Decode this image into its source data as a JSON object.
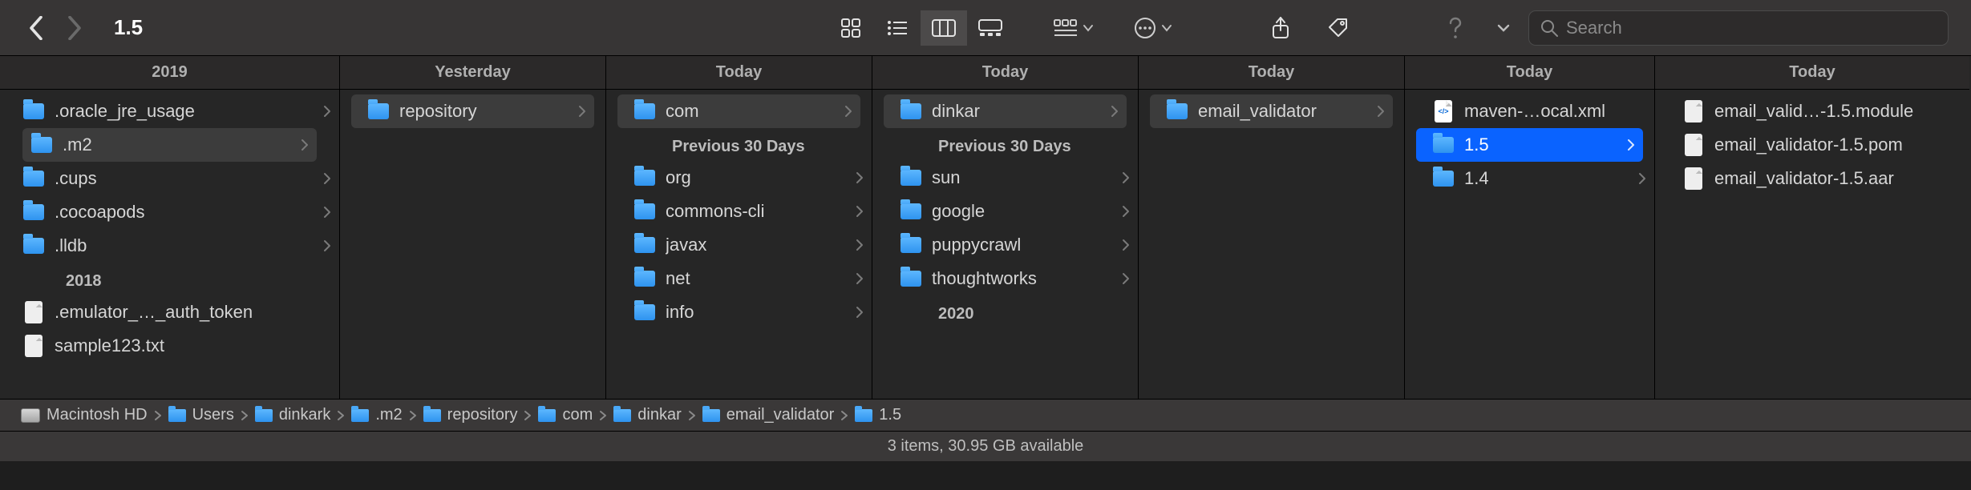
{
  "window": {
    "title": "1.5"
  },
  "search": {
    "placeholder": "Search"
  },
  "columns": [
    {
      "header": "2019",
      "sections": [
        {
          "label": "",
          "items": [
            {
              "name": ".oracle_jre_usage",
              "type": "folder",
              "has_children": true
            },
            {
              "name": ".m2",
              "type": "folder",
              "has_children": true,
              "selected": "light"
            },
            {
              "name": ".cups",
              "type": "folder",
              "has_children": true
            },
            {
              "name": ".cocoapods",
              "type": "folder",
              "has_children": true
            },
            {
              "name": ".lldb",
              "type": "folder",
              "has_children": true
            }
          ]
        },
        {
          "label": "2018",
          "items": [
            {
              "name": ".emulator_…_auth_token",
              "type": "file"
            },
            {
              "name": "sample123.txt",
              "type": "file"
            }
          ]
        }
      ]
    },
    {
      "header": "Yesterday",
      "sections": [
        {
          "label": "",
          "items": [
            {
              "name": "repository",
              "type": "folder",
              "has_children": true,
              "selected": "light"
            }
          ]
        }
      ]
    },
    {
      "header": "Today",
      "sections": [
        {
          "label": "",
          "items": [
            {
              "name": "com",
              "type": "folder",
              "has_children": true,
              "selected": "light"
            }
          ]
        },
        {
          "label": "Previous 30 Days",
          "items": [
            {
              "name": "org",
              "type": "folder",
              "has_children": true
            },
            {
              "name": "commons-cli",
              "type": "folder",
              "has_children": true
            },
            {
              "name": "javax",
              "type": "folder",
              "has_children": true
            },
            {
              "name": "net",
              "type": "folder",
              "has_children": true
            },
            {
              "name": "info",
              "type": "folder",
              "has_children": true
            }
          ]
        }
      ]
    },
    {
      "header": "Today",
      "sections": [
        {
          "label": "",
          "items": [
            {
              "name": "dinkar",
              "type": "folder",
              "has_children": true,
              "selected": "light"
            }
          ]
        },
        {
          "label": "Previous 30 Days",
          "items": [
            {
              "name": "sun",
              "type": "folder",
              "has_children": true
            },
            {
              "name": "google",
              "type": "folder",
              "has_children": true
            },
            {
              "name": "puppycrawl",
              "type": "folder",
              "has_children": true
            },
            {
              "name": "thoughtworks",
              "type": "folder",
              "has_children": true
            }
          ]
        },
        {
          "label": "2020",
          "items": []
        }
      ]
    },
    {
      "header": "Today",
      "sections": [
        {
          "label": "",
          "items": [
            {
              "name": "email_validator",
              "type": "folder",
              "has_children": true,
              "selected": "light"
            }
          ]
        }
      ]
    },
    {
      "header": "Today",
      "sections": [
        {
          "label": "",
          "items": [
            {
              "name": "maven-…ocal.xml",
              "type": "file-xml"
            },
            {
              "name": "1.5",
              "type": "folder",
              "has_children": true,
              "selected": "blue"
            },
            {
              "name": "1.4",
              "type": "folder",
              "has_children": true
            }
          ]
        }
      ]
    },
    {
      "header": "Today",
      "sections": [
        {
          "label": "",
          "items": [
            {
              "name": "email_valid…-1.5.module",
              "type": "file"
            },
            {
              "name": "email_validator-1.5.pom",
              "type": "file"
            },
            {
              "name": "email_validator-1.5.aar",
              "type": "file"
            }
          ]
        }
      ]
    }
  ],
  "path": [
    {
      "name": "Macintosh HD",
      "icon": "hd"
    },
    {
      "name": "Users",
      "icon": "folder"
    },
    {
      "name": "dinkark",
      "icon": "folder"
    },
    {
      "name": ".m2",
      "icon": "folder"
    },
    {
      "name": "repository",
      "icon": "folder"
    },
    {
      "name": "com",
      "icon": "folder"
    },
    {
      "name": "dinkar",
      "icon": "folder"
    },
    {
      "name": "email_validator",
      "icon": "folder"
    },
    {
      "name": "1.5",
      "icon": "folder"
    }
  ],
  "status": "3 items, 30.95 GB available"
}
